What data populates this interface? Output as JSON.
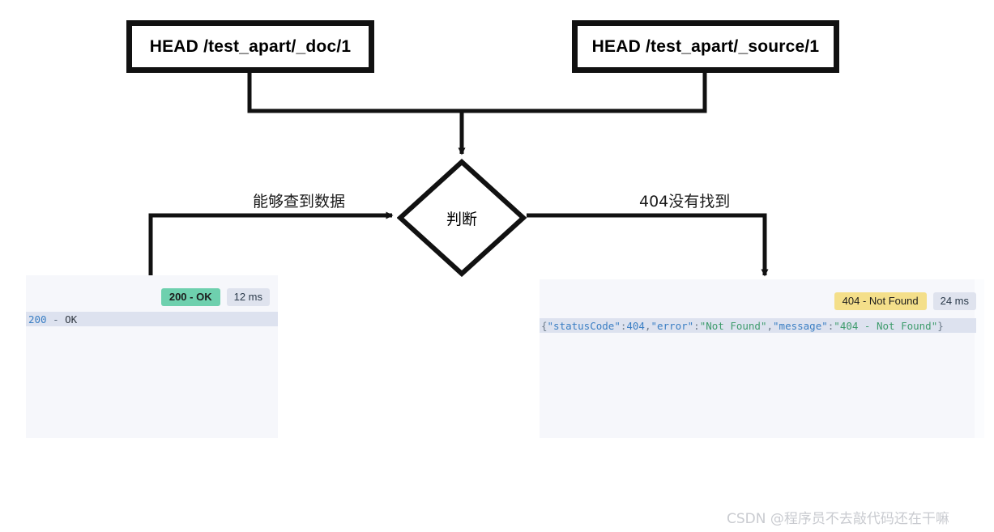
{
  "diagram": {
    "nodes": {
      "box_doc": "HEAD /test_apart/_doc/1",
      "box_source": "HEAD /test_apart/_source/1",
      "decision": "判断"
    },
    "edge_labels": {
      "left": "能够查到数据",
      "right": "404没有找到"
    }
  },
  "panels": {
    "ok": {
      "status_badge": "200 - OK",
      "time_badge": "12 ms",
      "body_tokens": {
        "code": "200",
        "dash": " - ",
        "text": "OK"
      }
    },
    "not_found": {
      "status_badge": "404 - Not Found",
      "time_badge": "24 ms",
      "body_tokens": {
        "open_brace": "{",
        "key_status": "\"statusCode\"",
        "colon1": ":",
        "val_status": "404",
        "comma1": ",",
        "key_error": "\"error\"",
        "colon2": ":",
        "val_error": "\"Not Found\"",
        "comma2": ",",
        "key_message": "\"message\"",
        "colon3": ":",
        "val_message": "\"404 - Not Found\"",
        "close_brace": "}"
      }
    }
  },
  "watermark": "CSDN @程序员不去敲代码还在干嘛",
  "colors": {
    "stroke": "#111111",
    "panel_bg": "#f6f7fb",
    "code_line_bg": "#dde2ef",
    "badge_ok": "#6ed0ae",
    "badge_err": "#f4df8a",
    "badge_time": "#dfe3ee",
    "watermark": "#c9cbd0"
  }
}
